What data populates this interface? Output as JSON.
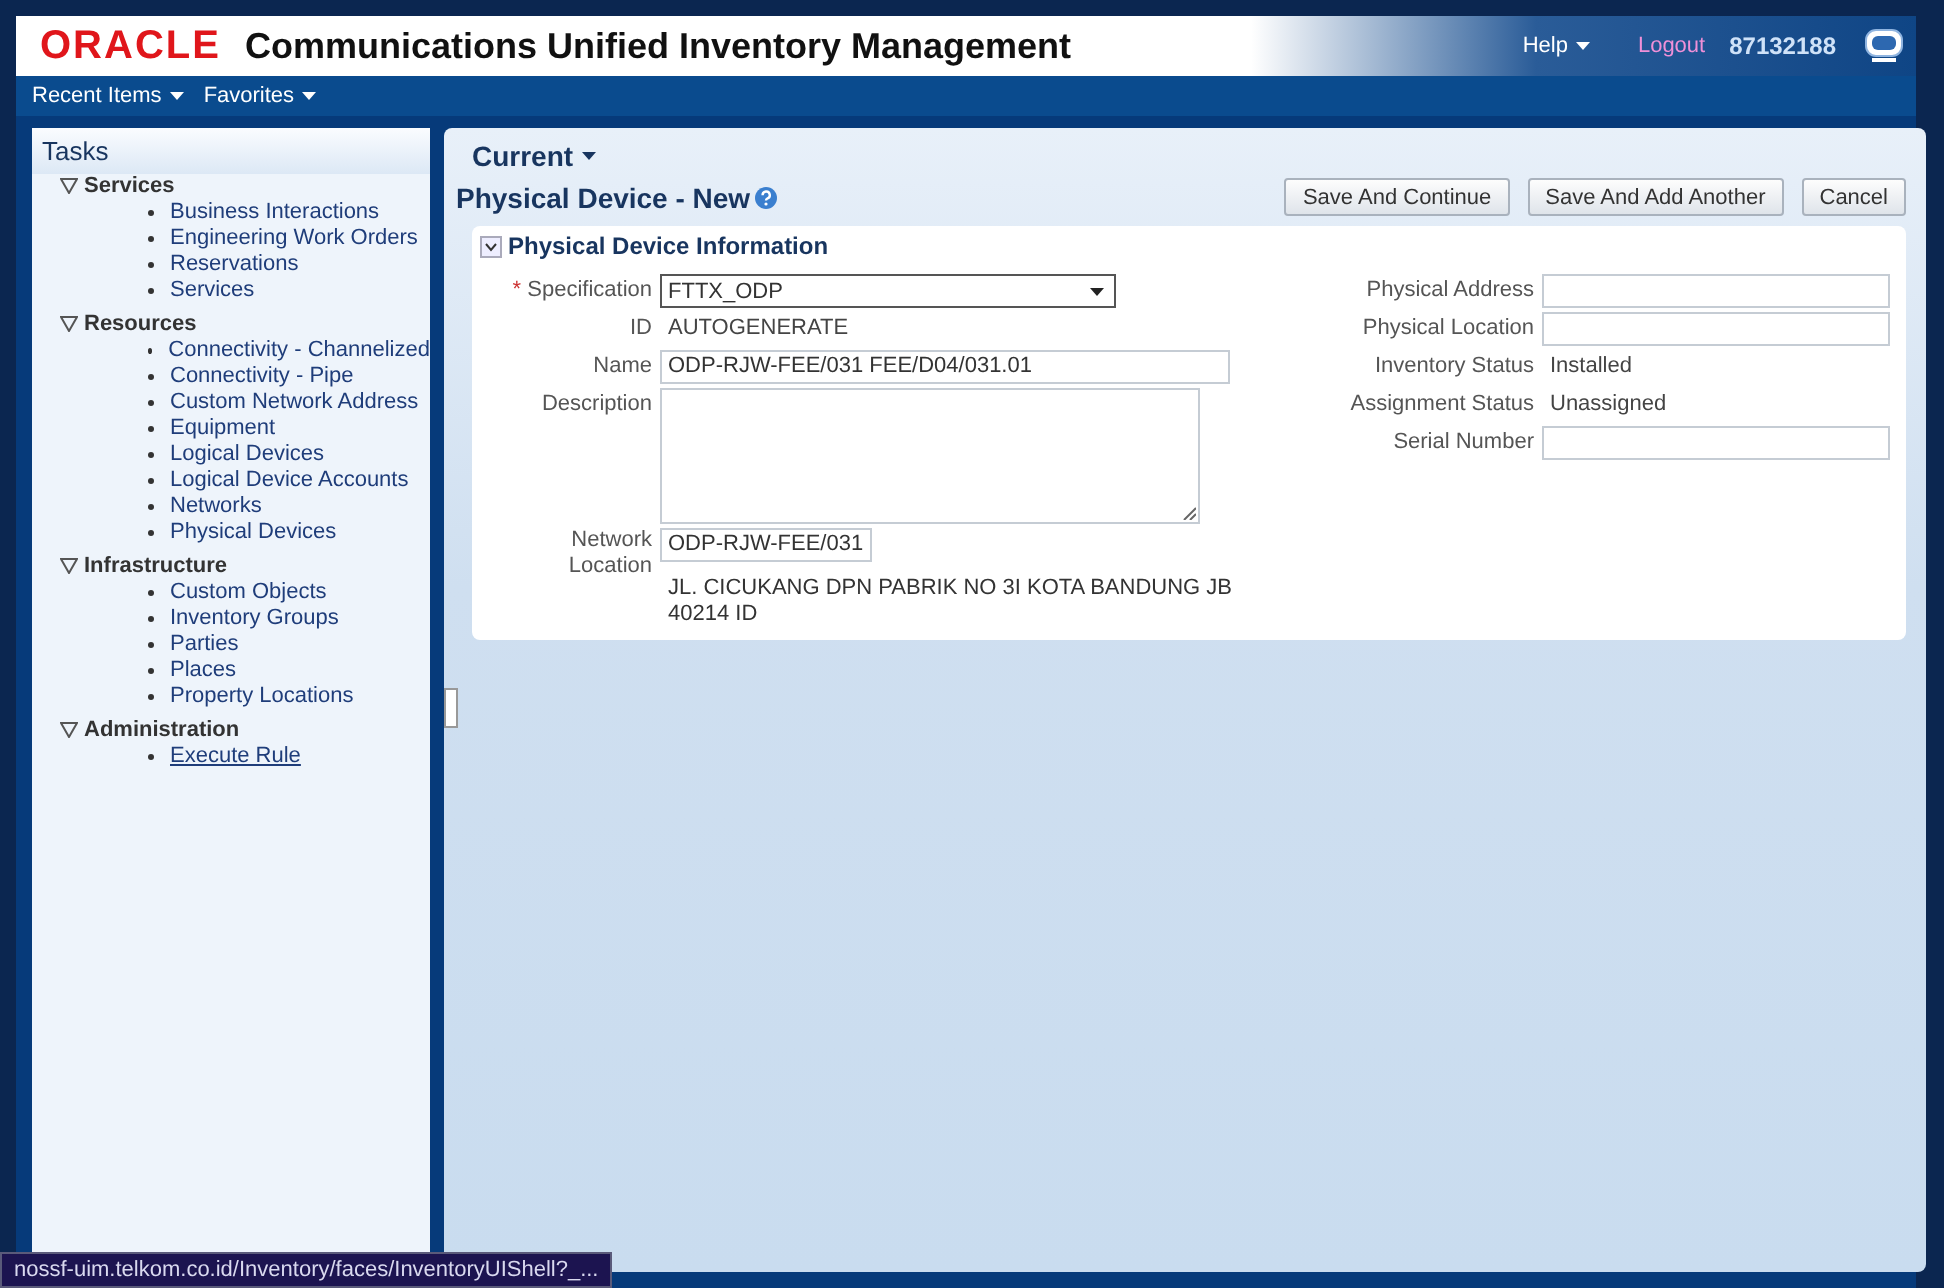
{
  "header": {
    "logo": "ORACLE",
    "title": "Communications Unified Inventory Management",
    "help": "Help",
    "logout": "Logout",
    "user": "87132188"
  },
  "nav": [
    "Recent Items",
    "Favorites"
  ],
  "tasks": {
    "title": "Tasks",
    "groups": [
      {
        "label": "Services",
        "expanded": true,
        "items": [
          {
            "label": "Business Interactions",
            "hovered": false
          },
          {
            "label": "Engineering Work Orders",
            "hovered": false
          },
          {
            "label": "Reservations",
            "hovered": false
          },
          {
            "label": "Services",
            "hovered": false
          }
        ]
      },
      {
        "label": "Resources",
        "expanded": true,
        "items": [
          {
            "label": "Connectivity - Channelized",
            "hovered": false
          },
          {
            "label": "Connectivity - Pipe",
            "hovered": false
          },
          {
            "label": "Custom Network Address",
            "hovered": false
          },
          {
            "label": "Equipment",
            "hovered": false
          },
          {
            "label": "Logical Devices",
            "hovered": false
          },
          {
            "label": "Logical Device Accounts",
            "hovered": false
          },
          {
            "label": "Networks",
            "hovered": false
          },
          {
            "label": "Physical Devices",
            "hovered": false
          }
        ]
      },
      {
        "label": "Infrastructure",
        "expanded": true,
        "items": [
          {
            "label": "Custom Objects",
            "hovered": false
          },
          {
            "label": "Inventory Groups",
            "hovered": false
          },
          {
            "label": "Parties",
            "hovered": false
          },
          {
            "label": "Places",
            "hovered": false
          },
          {
            "label": "Property Locations",
            "hovered": false
          }
        ]
      },
      {
        "label": "Administration",
        "expanded": true,
        "items": [
          {
            "label": "Execute Rule",
            "hovered": true
          }
        ]
      }
    ]
  },
  "content": {
    "current": "Current",
    "title": "Physical Device - New",
    "buttons": [
      "Save And Continue",
      "Save And Add Another",
      "Cancel"
    ],
    "section": {
      "title": "Physical Device Information",
      "expanded": true,
      "left_fields": [
        {
          "kind": "select",
          "label": "Specification",
          "required_mark": "*",
          "value": "FTTX_ODP"
        },
        {
          "kind": "text",
          "label": "ID",
          "value": "AUTOGENERATE"
        },
        {
          "kind": "input",
          "label": "Name",
          "value": "ODP-RJW-FEE/031 FEE/D04/031.01"
        },
        {
          "kind": "textarea",
          "label": "Description"
        },
        {
          "kind": "location",
          "label": "Network Location",
          "value": "ODP-RJW-FEE/031",
          "note": "JL. CICUKANG DPN PABRIK NO 3I KOTA BANDUNG JB 40214 ID"
        }
      ],
      "right_fields": [
        {
          "kind": "input",
          "label": "Physical Address"
        },
        {
          "kind": "input",
          "label": "Physical Location"
        },
        {
          "kind": "text",
          "label": "Inventory Status",
          "value": "Installed"
        },
        {
          "kind": "text",
          "label": "Assignment Status",
          "value": "Unassigned"
        },
        {
          "kind": "input",
          "label": "Serial Number"
        }
      ]
    }
  },
  "status_bar": "nossf-uim.telkom.co.id/Inventory/faces/InventoryUIShell?_..."
}
